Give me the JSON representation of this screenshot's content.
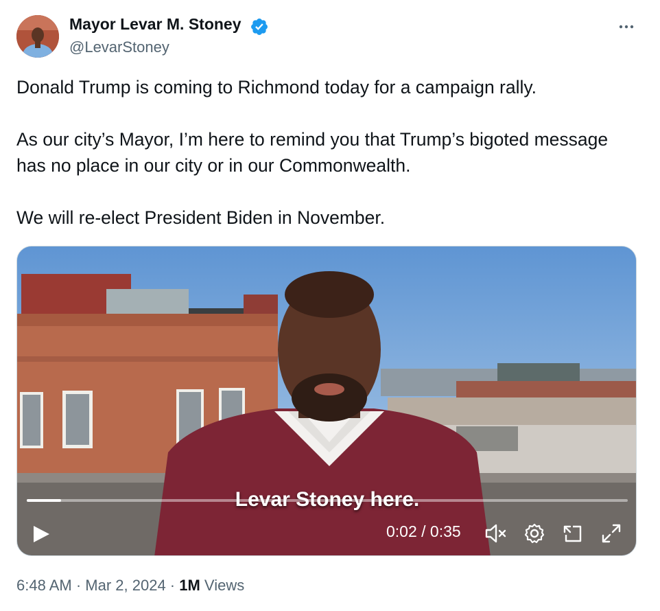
{
  "author": {
    "name": "Mayor Levar M. Stoney",
    "handle": "@LevarStoney",
    "verified": true,
    "verified_color": "#1d9bf0"
  },
  "tweet": {
    "paragraphs": [
      [
        "Donald Trump is coming to Richmond today for a campaign rally."
      ],
      [
        "As our city’s Mayor, I’m here to remind you that Trump’s bigoted message",
        "has no place in our city or in our Commonwealth."
      ],
      [
        "We will re-elect President Biden in November."
      ]
    ]
  },
  "video": {
    "caption": "Levar Stoney here.",
    "time_display": "0:02 / 0:35",
    "progress_fraction": 0.057,
    "controls": [
      "play-icon",
      "volume-muted-icon",
      "settings-gear-icon",
      "picture-in-picture-icon",
      "fullscreen-icon"
    ]
  },
  "meta": {
    "time": "6:48 AM",
    "separator": " · ",
    "date": "Mar 2, 2024",
    "views_count": "1M",
    "views_label": " Views"
  },
  "colors": {
    "text_primary": "#0f1419",
    "text_secondary": "#536471",
    "border": "#cfd9de"
  }
}
